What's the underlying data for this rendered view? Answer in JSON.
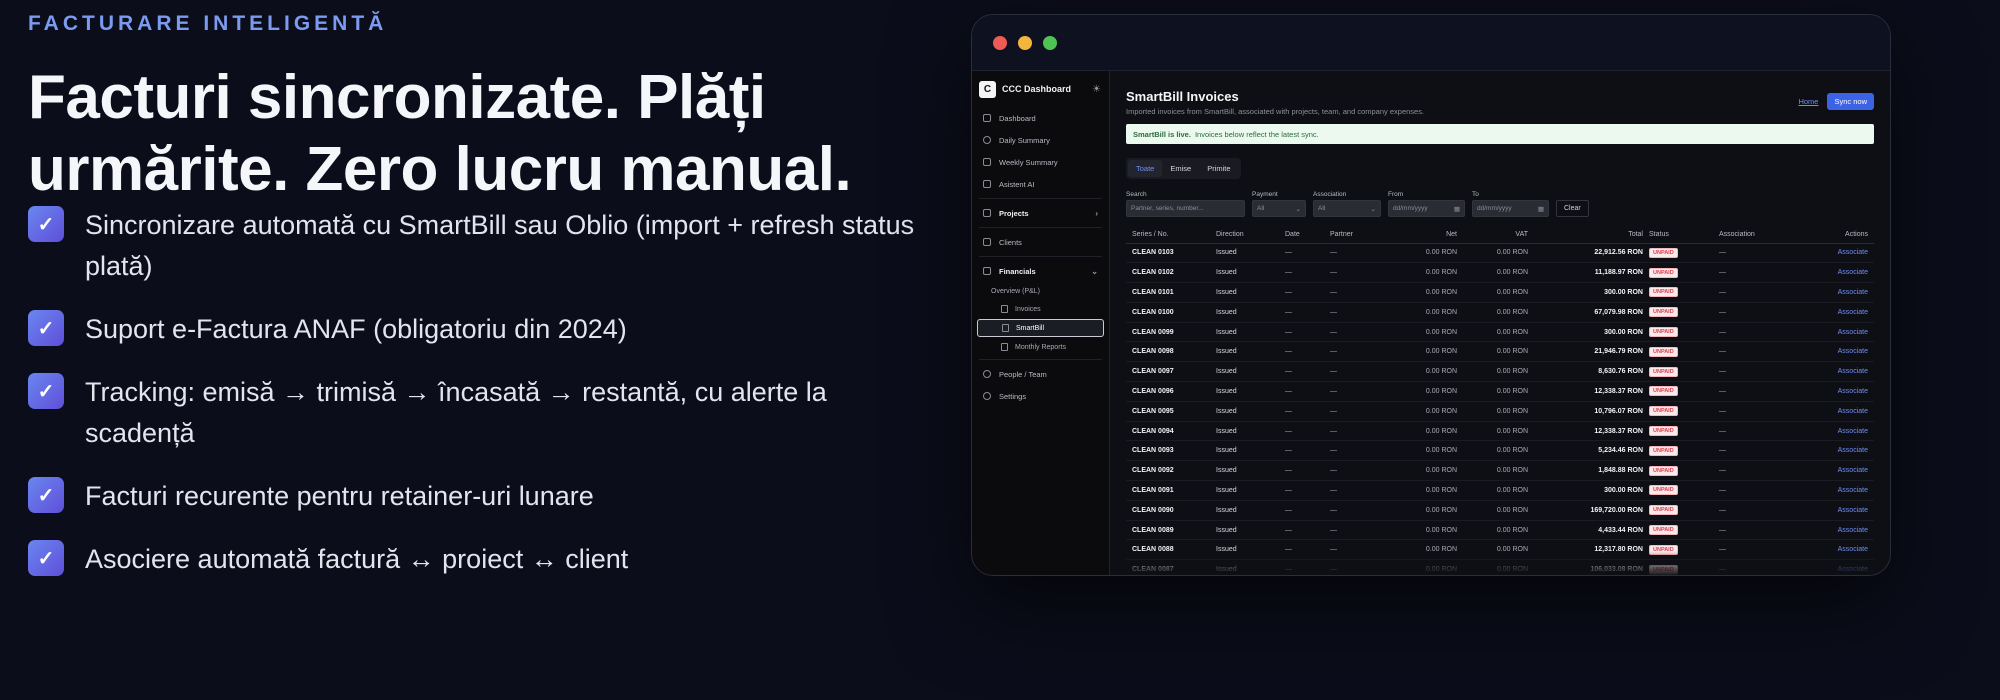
{
  "eyebrow": "FACTURARE INTELIGENTĂ",
  "headline": {
    "line1": "Facturi sincronizate. Plăți",
    "line2": "urmărite. Zero lucru manual."
  },
  "features": [
    "Sincronizare automată cu SmartBill sau Oblio (import + refresh status plată)",
    "Suport e-Factura ANAF (obligatoriu din 2024)",
    "Tracking: emisă → trimisă → încasată → restantă, cu alerte la scadență",
    "Facturi recurente pentru retainer-uri lunare",
    "Asociere automată factură ↔ proiect ↔ client"
  ],
  "check_glyph": "✓",
  "colors": {
    "background": "#0b0d1a",
    "accent": "#7b9bf0",
    "check_gradient_start": "#6a86f0",
    "check_gradient_end": "#5f4fd8",
    "link": "#6f8ef5",
    "primary_button": "#3c63e6",
    "unpaid_badge": "#d8424f"
  },
  "app": {
    "brand": {
      "logo": "C",
      "name": "CCC Dashboard",
      "settings_icon": "sun-icon"
    },
    "sidebar": {
      "dashboard": "Dashboard",
      "daily_summary": "Daily Summary",
      "weekly_summary": "Weekly Summary",
      "assistant": "Asistent AI",
      "projects": "Projects",
      "clients": "Clients",
      "financials": "Financials",
      "overview": "Overview (P&L)",
      "invoices": "Invoices",
      "smartbill": "SmartBill",
      "monthly_reports": "Monthly Reports",
      "people": "People / Team",
      "settings": "Settings"
    },
    "page": {
      "title": "SmartBill Invoices",
      "subtitle": "Imported invoices from SmartBill, associated with projects, team, and company expenses.",
      "home_link": "Home",
      "sync_button": "Sync now",
      "banner_bold": "SmartBill is live.",
      "banner_text": "Invoices below reflect the latest sync."
    },
    "tabs": [
      "Toate",
      "Emise",
      "Primite"
    ],
    "filters": {
      "search_label": "Search",
      "search_placeholder": "Partner, series, number...",
      "payment_label": "Payment",
      "payment_value": "All",
      "association_label": "Association",
      "association_value": "All",
      "from_label": "From",
      "from_placeholder": "dd/mm/yyyy",
      "to_label": "To",
      "to_placeholder": "dd/mm/yyyy",
      "clear_button": "Clear"
    },
    "table": {
      "columns": [
        "Series / No.",
        "Direction",
        "Date",
        "Partner",
        "Net",
        "VAT",
        "Total",
        "Status",
        "Association",
        "Actions"
      ],
      "rows": [
        {
          "series": "CLEAN 0103",
          "direction": "Issued",
          "date": "—",
          "partner": "—",
          "net": "0.00 RON",
          "vat": "0.00 RON",
          "total": "22,912.56 RON",
          "status": "UNPAID",
          "association": "—",
          "action": "Associate"
        },
        {
          "series": "CLEAN 0102",
          "direction": "Issued",
          "date": "—",
          "partner": "—",
          "net": "0.00 RON",
          "vat": "0.00 RON",
          "total": "11,188.97 RON",
          "status": "UNPAID",
          "association": "—",
          "action": "Associate"
        },
        {
          "series": "CLEAN 0101",
          "direction": "Issued",
          "date": "—",
          "partner": "—",
          "net": "0.00 RON",
          "vat": "0.00 RON",
          "total": "300.00 RON",
          "status": "UNPAID",
          "association": "—",
          "action": "Associate"
        },
        {
          "series": "CLEAN 0100",
          "direction": "Issued",
          "date": "—",
          "partner": "—",
          "net": "0.00 RON",
          "vat": "0.00 RON",
          "total": "67,079.98 RON",
          "status": "UNPAID",
          "association": "—",
          "action": "Associate"
        },
        {
          "series": "CLEAN 0099",
          "direction": "Issued",
          "date": "—",
          "partner": "—",
          "net": "0.00 RON",
          "vat": "0.00 RON",
          "total": "300.00 RON",
          "status": "UNPAID",
          "association": "—",
          "action": "Associate"
        },
        {
          "series": "CLEAN 0098",
          "direction": "Issued",
          "date": "—",
          "partner": "—",
          "net": "0.00 RON",
          "vat": "0.00 RON",
          "total": "21,946.79 RON",
          "status": "UNPAID",
          "association": "—",
          "action": "Associate"
        },
        {
          "series": "CLEAN 0097",
          "direction": "Issued",
          "date": "—",
          "partner": "—",
          "net": "0.00 RON",
          "vat": "0.00 RON",
          "total": "8,630.76 RON",
          "status": "UNPAID",
          "association": "—",
          "action": "Associate"
        },
        {
          "series": "CLEAN 0096",
          "direction": "Issued",
          "date": "—",
          "partner": "—",
          "net": "0.00 RON",
          "vat": "0.00 RON",
          "total": "12,338.37 RON",
          "status": "UNPAID",
          "association": "—",
          "action": "Associate"
        },
        {
          "series": "CLEAN 0095",
          "direction": "Issued",
          "date": "—",
          "partner": "—",
          "net": "0.00 RON",
          "vat": "0.00 RON",
          "total": "10,796.07 RON",
          "status": "UNPAID",
          "association": "—",
          "action": "Associate"
        },
        {
          "series": "CLEAN 0094",
          "direction": "Issued",
          "date": "—",
          "partner": "—",
          "net": "0.00 RON",
          "vat": "0.00 RON",
          "total": "12,338.37 RON",
          "status": "UNPAID",
          "association": "—",
          "action": "Associate"
        },
        {
          "series": "CLEAN 0093",
          "direction": "Issued",
          "date": "—",
          "partner": "—",
          "net": "0.00 RON",
          "vat": "0.00 RON",
          "total": "5,234.46 RON",
          "status": "UNPAID",
          "association": "—",
          "action": "Associate"
        },
        {
          "series": "CLEAN 0092",
          "direction": "Issued",
          "date": "—",
          "partner": "—",
          "net": "0.00 RON",
          "vat": "0.00 RON",
          "total": "1,848.88 RON",
          "status": "UNPAID",
          "association": "—",
          "action": "Associate"
        },
        {
          "series": "CLEAN 0091",
          "direction": "Issued",
          "date": "—",
          "partner": "—",
          "net": "0.00 RON",
          "vat": "0.00 RON",
          "total": "300.00 RON",
          "status": "UNPAID",
          "association": "—",
          "action": "Associate"
        },
        {
          "series": "CLEAN 0090",
          "direction": "Issued",
          "date": "—",
          "partner": "—",
          "net": "0.00 RON",
          "vat": "0.00 RON",
          "total": "169,720.00 RON",
          "status": "UNPAID",
          "association": "—",
          "action": "Associate"
        },
        {
          "series": "CLEAN 0089",
          "direction": "Issued",
          "date": "—",
          "partner": "—",
          "net": "0.00 RON",
          "vat": "0.00 RON",
          "total": "4,433.44 RON",
          "status": "UNPAID",
          "association": "—",
          "action": "Associate"
        },
        {
          "series": "CLEAN 0088",
          "direction": "Issued",
          "date": "—",
          "partner": "—",
          "net": "0.00 RON",
          "vat": "0.00 RON",
          "total": "12,317.80 RON",
          "status": "UNPAID",
          "association": "—",
          "action": "Associate"
        },
        {
          "series": "CLEAN 0087",
          "direction": "Issued",
          "date": "—",
          "partner": "—",
          "net": "0.00 RON",
          "vat": "0.00 RON",
          "total": "106,033.08 RON",
          "status": "UNPAID",
          "association": "—",
          "action": "Associate"
        }
      ]
    }
  }
}
